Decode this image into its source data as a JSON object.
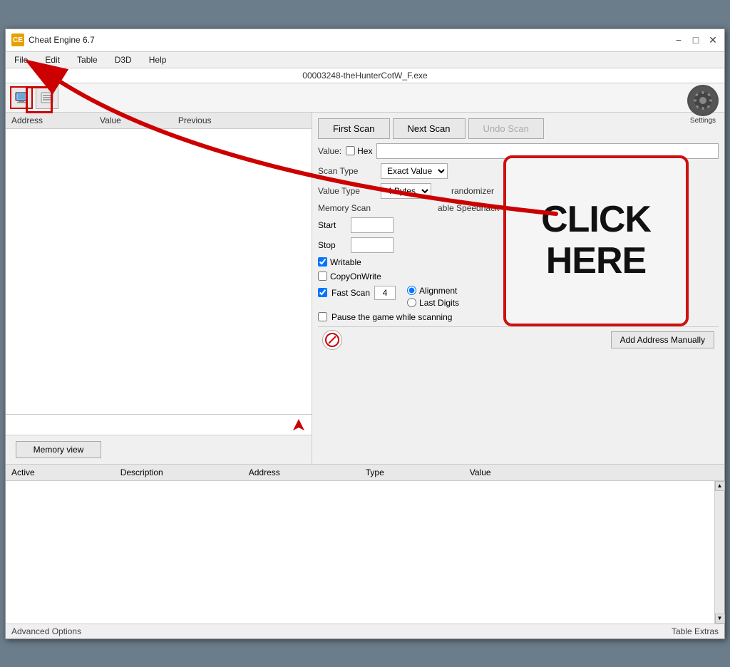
{
  "window": {
    "title": "Cheat Engine 6.7",
    "process": "00003248-theHunterCotW_F.exe"
  },
  "menubar": {
    "items": [
      "File",
      "Edit",
      "Table",
      "D3D",
      "Help"
    ]
  },
  "toolbar": {
    "settings_label": "Settings"
  },
  "left_panel": {
    "headers": [
      "Address",
      "Value",
      "Previous"
    ]
  },
  "scan": {
    "first_scan": "First Scan",
    "next_scan": "Next Scan",
    "undo_scan": "Undo Scan",
    "value_label": "Value:",
    "hex_label": "Hex",
    "scan_type_label": "Scan Type",
    "scan_type_value": "Exact Value",
    "value_type_label": "Value Type",
    "value_type_value": "4 Bytes",
    "memory_scan_label": "Memory Scan",
    "start_label": "Start",
    "stop_label": "Stop",
    "writable_label": "Writable",
    "copy_on_write_label": "CopyOnWrite",
    "fast_scan_label": "Fast Scan",
    "fast_scan_value": "4",
    "alignment_label": "Alignment",
    "last_digits_label": "Last Digits",
    "pause_label": "Pause the game while scanning",
    "randomizer_label": "randomizer",
    "enable_speedhack_label": "able Speedhack"
  },
  "bottom_panel": {
    "headers": [
      "Active",
      "Description",
      "Address",
      "Type",
      "Value"
    ]
  },
  "buttons": {
    "memory_view": "Memory view",
    "add_address": "Add Address Manually"
  },
  "status_bar": {
    "left": "Advanced Options",
    "right": "Table Extras"
  },
  "overlay": {
    "click_here_line1": "CLICK",
    "click_here_line2": "HERE"
  }
}
